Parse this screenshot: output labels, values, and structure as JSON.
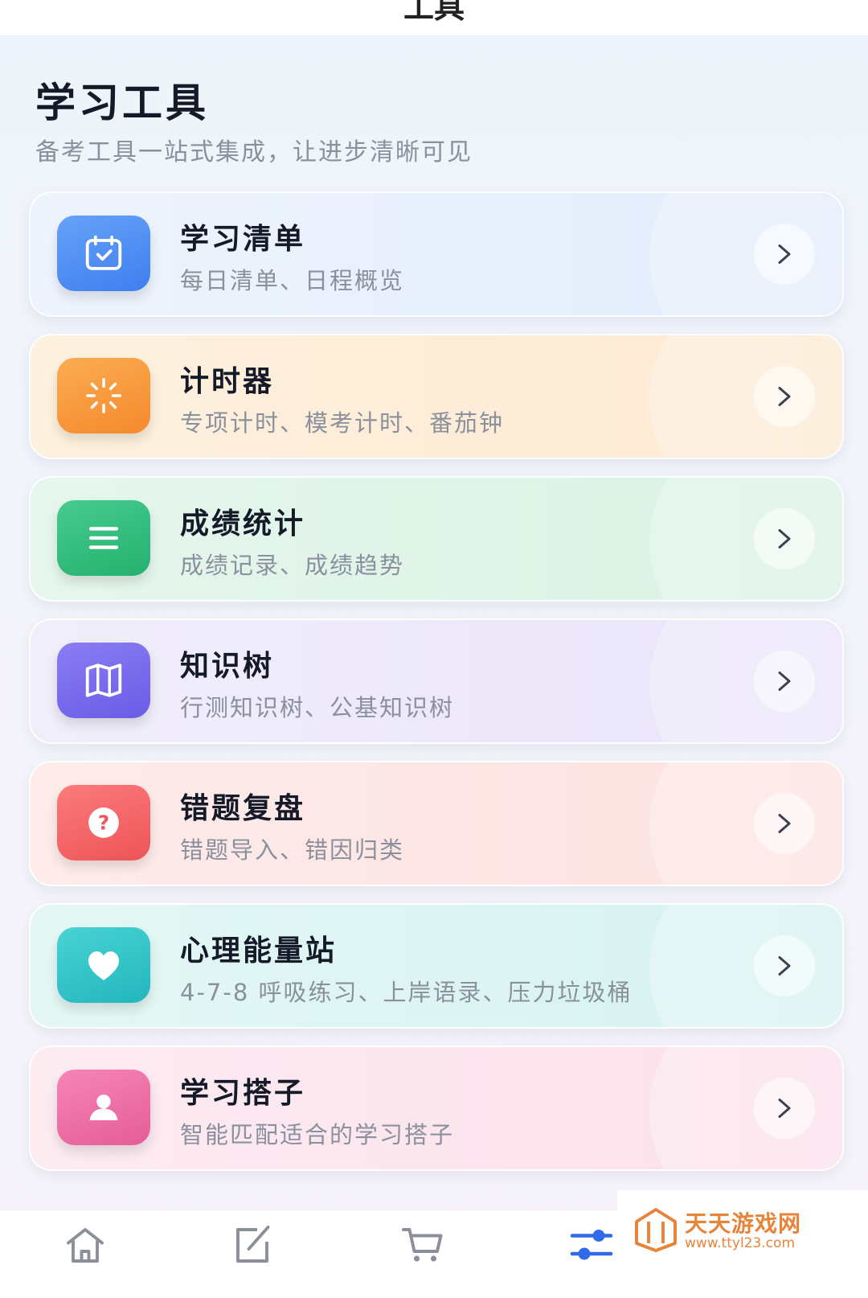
{
  "topbar": {
    "title": "工具"
  },
  "header": {
    "title": "学习工具",
    "subtitle": "备考工具一站式集成，让进步清晰可见"
  },
  "cards": [
    {
      "title": "学习清单",
      "desc": "每日清单、日程概览",
      "icon": "calendar-check-icon",
      "accent": "#4f8ef5",
      "bg": "#e4eefc"
    },
    {
      "title": "计时器",
      "desc": "专项计时、模考计时、番茄钟",
      "icon": "loading-timer-icon",
      "accent": "#f79a3a",
      "bg": "#fdebd4"
    },
    {
      "title": "成绩统计",
      "desc": "成绩记录、成绩趋势",
      "icon": "list-lines-icon",
      "accent": "#2fbf7f",
      "bg": "#dcf3e6"
    },
    {
      "title": "知识树",
      "desc": "行测知识树、公基知识树",
      "icon": "map-icon",
      "accent": "#7b6cf0",
      "bg": "#ebe6fb"
    },
    {
      "title": "错题复盘",
      "desc": "错题导入、错因归类",
      "icon": "question-icon",
      "accent": "#f46468",
      "bg": "#fde4e3"
    },
    {
      "title": "心理能量站",
      "desc": "4-7-8 呼吸练习、上岸语录、压力垃圾桶",
      "icon": "heart-icon",
      "accent": "#2fc2c8",
      "bg": "#d9f3f2"
    },
    {
      "title": "学习搭子",
      "desc": "智能匹配适合的学习搭子",
      "icon": "user-icon",
      "accent": "#ef6fa6",
      "bg": "#fbe1ec"
    }
  ],
  "bottom_nav": [
    {
      "icon": "home-icon",
      "active": false
    },
    {
      "icon": "edit-icon",
      "active": false
    },
    {
      "icon": "cart-icon",
      "active": false
    },
    {
      "icon": "sliders-icon",
      "active": true
    }
  ],
  "watermark": {
    "name": "天天游戏网",
    "url": "www.ttyl23.com",
    "color": "#e8833a"
  }
}
